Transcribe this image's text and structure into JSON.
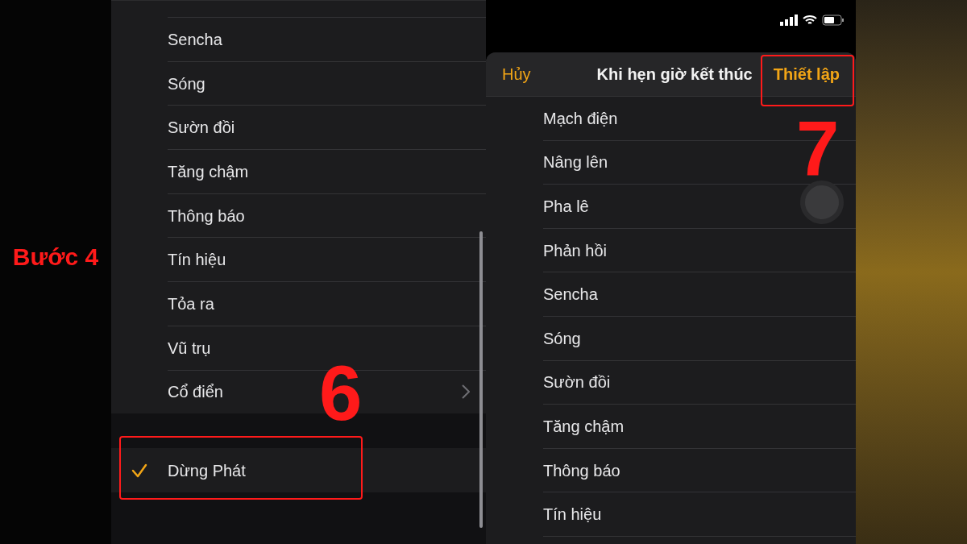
{
  "step_label": "Bước 4",
  "left_screen": {
    "items": [
      {
        "label": "Sencha",
        "kind": "plain"
      },
      {
        "label": "Sóng",
        "kind": "plain"
      },
      {
        "label": "Sườn đồi",
        "kind": "plain"
      },
      {
        "label": "Tăng chậm",
        "kind": "plain"
      },
      {
        "label": "Thông báo",
        "kind": "plain"
      },
      {
        "label": "Tín hiệu",
        "kind": "plain"
      },
      {
        "label": "Tỏa ra",
        "kind": "plain"
      },
      {
        "label": "Vũ trụ",
        "kind": "plain"
      },
      {
        "label": "Cổ điển",
        "kind": "submenu"
      }
    ],
    "stop_option": {
      "label": "Dừng Phát",
      "checked": true
    }
  },
  "right_screen": {
    "header": {
      "cancel": "Hủy",
      "title": "Khi hẹn giờ kết thúc",
      "confirm": "Thiết lập"
    },
    "items": [
      "Mạch điện",
      "Nâng lên",
      "Pha lê",
      "Phản hồi",
      "Sencha",
      "Sóng",
      "Sườn đồi",
      "Tăng chậm",
      "Thông báo",
      "Tín hiệu"
    ]
  },
  "annotations": [
    {
      "number": "6"
    },
    {
      "number": "7"
    }
  ]
}
